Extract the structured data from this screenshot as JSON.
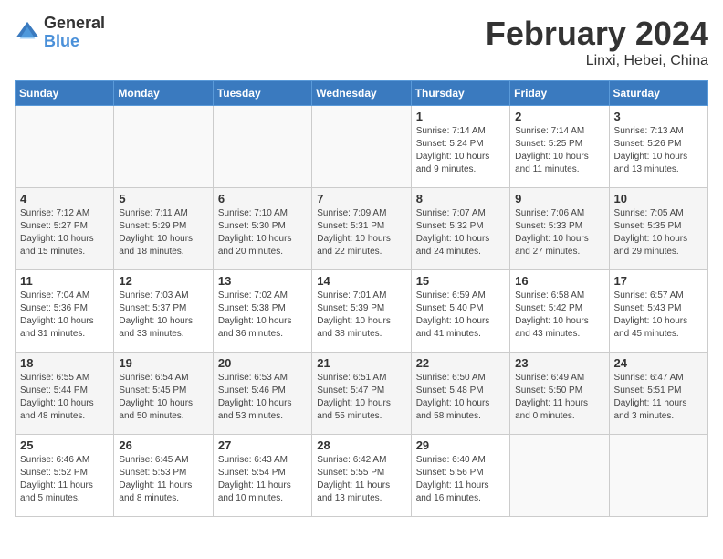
{
  "logo": {
    "general": "General",
    "blue": "Blue"
  },
  "title": "February 2024",
  "location": "Linxi, Hebei, China",
  "days_of_week": [
    "Sunday",
    "Monday",
    "Tuesday",
    "Wednesday",
    "Thursday",
    "Friday",
    "Saturday"
  ],
  "weeks": [
    [
      {
        "day": "",
        "info": ""
      },
      {
        "day": "",
        "info": ""
      },
      {
        "day": "",
        "info": ""
      },
      {
        "day": "",
        "info": ""
      },
      {
        "day": "1",
        "info": "Sunrise: 7:14 AM\nSunset: 5:24 PM\nDaylight: 10 hours\nand 9 minutes."
      },
      {
        "day": "2",
        "info": "Sunrise: 7:14 AM\nSunset: 5:25 PM\nDaylight: 10 hours\nand 11 minutes."
      },
      {
        "day": "3",
        "info": "Sunrise: 7:13 AM\nSunset: 5:26 PM\nDaylight: 10 hours\nand 13 minutes."
      }
    ],
    [
      {
        "day": "4",
        "info": "Sunrise: 7:12 AM\nSunset: 5:27 PM\nDaylight: 10 hours\nand 15 minutes."
      },
      {
        "day": "5",
        "info": "Sunrise: 7:11 AM\nSunset: 5:29 PM\nDaylight: 10 hours\nand 18 minutes."
      },
      {
        "day": "6",
        "info": "Sunrise: 7:10 AM\nSunset: 5:30 PM\nDaylight: 10 hours\nand 20 minutes."
      },
      {
        "day": "7",
        "info": "Sunrise: 7:09 AM\nSunset: 5:31 PM\nDaylight: 10 hours\nand 22 minutes."
      },
      {
        "day": "8",
        "info": "Sunrise: 7:07 AM\nSunset: 5:32 PM\nDaylight: 10 hours\nand 24 minutes."
      },
      {
        "day": "9",
        "info": "Sunrise: 7:06 AM\nSunset: 5:33 PM\nDaylight: 10 hours\nand 27 minutes."
      },
      {
        "day": "10",
        "info": "Sunrise: 7:05 AM\nSunset: 5:35 PM\nDaylight: 10 hours\nand 29 minutes."
      }
    ],
    [
      {
        "day": "11",
        "info": "Sunrise: 7:04 AM\nSunset: 5:36 PM\nDaylight: 10 hours\nand 31 minutes."
      },
      {
        "day": "12",
        "info": "Sunrise: 7:03 AM\nSunset: 5:37 PM\nDaylight: 10 hours\nand 33 minutes."
      },
      {
        "day": "13",
        "info": "Sunrise: 7:02 AM\nSunset: 5:38 PM\nDaylight: 10 hours\nand 36 minutes."
      },
      {
        "day": "14",
        "info": "Sunrise: 7:01 AM\nSunset: 5:39 PM\nDaylight: 10 hours\nand 38 minutes."
      },
      {
        "day": "15",
        "info": "Sunrise: 6:59 AM\nSunset: 5:40 PM\nDaylight: 10 hours\nand 41 minutes."
      },
      {
        "day": "16",
        "info": "Sunrise: 6:58 AM\nSunset: 5:42 PM\nDaylight: 10 hours\nand 43 minutes."
      },
      {
        "day": "17",
        "info": "Sunrise: 6:57 AM\nSunset: 5:43 PM\nDaylight: 10 hours\nand 45 minutes."
      }
    ],
    [
      {
        "day": "18",
        "info": "Sunrise: 6:55 AM\nSunset: 5:44 PM\nDaylight: 10 hours\nand 48 minutes."
      },
      {
        "day": "19",
        "info": "Sunrise: 6:54 AM\nSunset: 5:45 PM\nDaylight: 10 hours\nand 50 minutes."
      },
      {
        "day": "20",
        "info": "Sunrise: 6:53 AM\nSunset: 5:46 PM\nDaylight: 10 hours\nand 53 minutes."
      },
      {
        "day": "21",
        "info": "Sunrise: 6:51 AM\nSunset: 5:47 PM\nDaylight: 10 hours\nand 55 minutes."
      },
      {
        "day": "22",
        "info": "Sunrise: 6:50 AM\nSunset: 5:48 PM\nDaylight: 10 hours\nand 58 minutes."
      },
      {
        "day": "23",
        "info": "Sunrise: 6:49 AM\nSunset: 5:50 PM\nDaylight: 11 hours\nand 0 minutes."
      },
      {
        "day": "24",
        "info": "Sunrise: 6:47 AM\nSunset: 5:51 PM\nDaylight: 11 hours\nand 3 minutes."
      }
    ],
    [
      {
        "day": "25",
        "info": "Sunrise: 6:46 AM\nSunset: 5:52 PM\nDaylight: 11 hours\nand 5 minutes."
      },
      {
        "day": "26",
        "info": "Sunrise: 6:45 AM\nSunset: 5:53 PM\nDaylight: 11 hours\nand 8 minutes."
      },
      {
        "day": "27",
        "info": "Sunrise: 6:43 AM\nSunset: 5:54 PM\nDaylight: 11 hours\nand 10 minutes."
      },
      {
        "day": "28",
        "info": "Sunrise: 6:42 AM\nSunset: 5:55 PM\nDaylight: 11 hours\nand 13 minutes."
      },
      {
        "day": "29",
        "info": "Sunrise: 6:40 AM\nSunset: 5:56 PM\nDaylight: 11 hours\nand 16 minutes."
      },
      {
        "day": "",
        "info": ""
      },
      {
        "day": "",
        "info": ""
      }
    ]
  ]
}
